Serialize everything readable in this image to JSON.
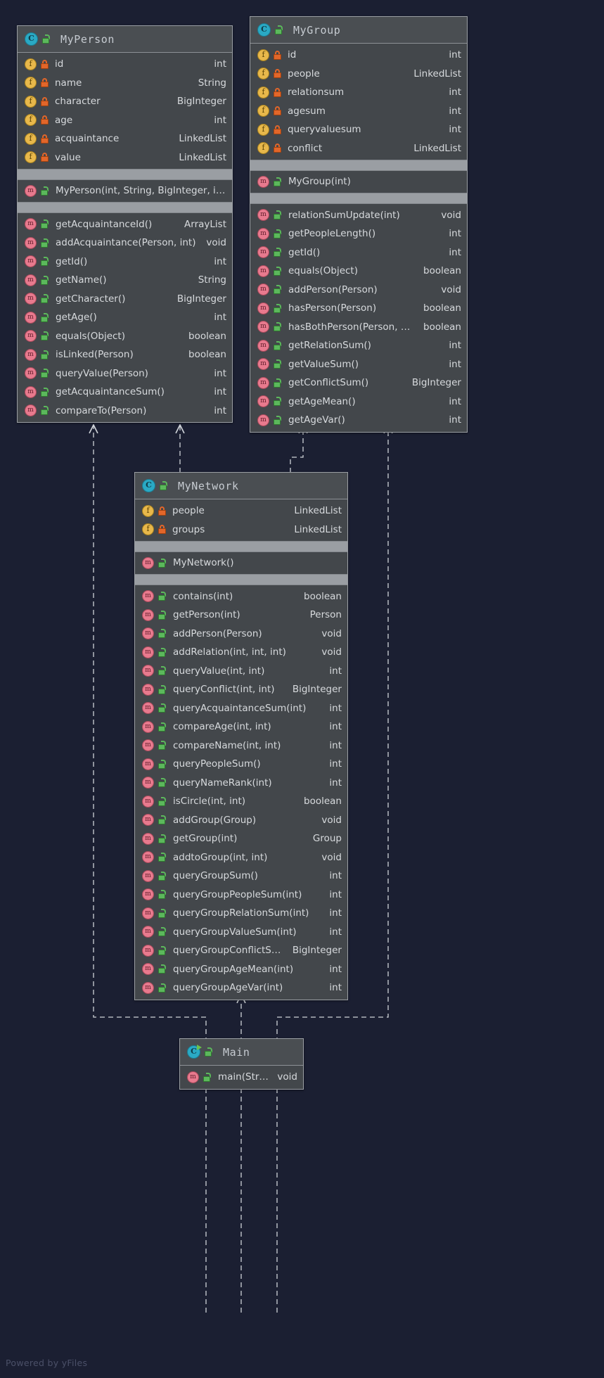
{
  "diagram": {
    "kind": "uml-class-diagram",
    "watermark": "Powered by yFiles",
    "background": "#1b1f32",
    "node_fill": "#43474b",
    "node_border": "#9a9ea3",
    "separator": "#9a9ea3",
    "text_color": "#d7dadd",
    "icons": {
      "class": "class-icon",
      "class_runnable": "class-runnable-icon",
      "field": "field-icon",
      "method": "method-icon",
      "private": "padlock-closed-icon",
      "public": "padlock-open-icon"
    },
    "edge_style": "dashed-hollow-triangle-realization"
  },
  "classes": [
    {
      "id": "myperson",
      "name": "MyPerson",
      "visibility": "public",
      "fields": [
        {
          "name": "id",
          "type": "int",
          "visibility": "private"
        },
        {
          "name": "name",
          "type": "String",
          "visibility": "private"
        },
        {
          "name": "character",
          "type": "BigInteger",
          "visibility": "private"
        },
        {
          "name": "age",
          "type": "int",
          "visibility": "private"
        },
        {
          "name": "acquaintance",
          "type": "LinkedList<Person>",
          "visibility": "private"
        },
        {
          "name": "value",
          "type": "LinkedList<Integer>",
          "visibility": "private"
        }
      ],
      "constructors": [
        {
          "name": "MyPerson(int, String, BigInteger, int)",
          "type": "",
          "visibility": "public"
        }
      ],
      "methods": [
        {
          "name": "getAcquaintanceId()",
          "type": "ArrayList<Integer>",
          "visibility": "public"
        },
        {
          "name": "addAcquaintance(Person, int)",
          "type": "void",
          "visibility": "public"
        },
        {
          "name": "getId()",
          "type": "int",
          "visibility": "public"
        },
        {
          "name": "getName()",
          "type": "String",
          "visibility": "public"
        },
        {
          "name": "getCharacter()",
          "type": "BigInteger",
          "visibility": "public"
        },
        {
          "name": "getAge()",
          "type": "int",
          "visibility": "public"
        },
        {
          "name": "equals(Object)",
          "type": "boolean",
          "visibility": "public"
        },
        {
          "name": "isLinked(Person)",
          "type": "boolean",
          "visibility": "public"
        },
        {
          "name": "queryValue(Person)",
          "type": "int",
          "visibility": "public"
        },
        {
          "name": "getAcquaintanceSum()",
          "type": "int",
          "visibility": "public"
        },
        {
          "name": "compareTo(Person)",
          "type": "int",
          "visibility": "public"
        }
      ]
    },
    {
      "id": "mygroup",
      "name": "MyGroup",
      "visibility": "public",
      "fields": [
        {
          "name": "id",
          "type": "int",
          "visibility": "private"
        },
        {
          "name": "people",
          "type": "LinkedList<Person>",
          "visibility": "private"
        },
        {
          "name": "relationsum",
          "type": "int",
          "visibility": "private"
        },
        {
          "name": "agesum",
          "type": "int",
          "visibility": "private"
        },
        {
          "name": "queryvaluesum",
          "type": "int",
          "visibility": "private"
        },
        {
          "name": "conflict",
          "type": "LinkedList<BigInteger>",
          "visibility": "private"
        }
      ],
      "constructors": [
        {
          "name": "MyGroup(int)",
          "type": "",
          "visibility": "public"
        }
      ],
      "methods": [
        {
          "name": "relationSumUpdate(int)",
          "type": "void",
          "visibility": "public"
        },
        {
          "name": "getPeopleLength()",
          "type": "int",
          "visibility": "public"
        },
        {
          "name": "getId()",
          "type": "int",
          "visibility": "public"
        },
        {
          "name": "equals(Object)",
          "type": "boolean",
          "visibility": "public"
        },
        {
          "name": "addPerson(Person)",
          "type": "void",
          "visibility": "public"
        },
        {
          "name": "hasPerson(Person)",
          "type": "boolean",
          "visibility": "public"
        },
        {
          "name": "hasBothPerson(Person, Person)",
          "type": "boolean",
          "visibility": "public"
        },
        {
          "name": "getRelationSum()",
          "type": "int",
          "visibility": "public"
        },
        {
          "name": "getValueSum()",
          "type": "int",
          "visibility": "public"
        },
        {
          "name": "getConflictSum()",
          "type": "BigInteger",
          "visibility": "public"
        },
        {
          "name": "getAgeMean()",
          "type": "int",
          "visibility": "public"
        },
        {
          "name": "getAgeVar()",
          "type": "int",
          "visibility": "public"
        }
      ]
    },
    {
      "id": "mynetwork",
      "name": "MyNetwork",
      "visibility": "public",
      "fields": [
        {
          "name": "people",
          "type": "LinkedList<Person>",
          "visibility": "private"
        },
        {
          "name": "groups",
          "type": "LinkedList<Group>",
          "visibility": "private"
        }
      ],
      "constructors": [
        {
          "name": "MyNetwork()",
          "type": "",
          "visibility": "public"
        }
      ],
      "methods": [
        {
          "name": "contains(int)",
          "type": "boolean",
          "visibility": "public"
        },
        {
          "name": "getPerson(int)",
          "type": "Person",
          "visibility": "public"
        },
        {
          "name": "addPerson(Person)",
          "type": "void",
          "visibility": "public"
        },
        {
          "name": "addRelation(int, int, int)",
          "type": "void",
          "visibility": "public"
        },
        {
          "name": "queryValue(int, int)",
          "type": "int",
          "visibility": "public"
        },
        {
          "name": "queryConflict(int, int)",
          "type": "BigInteger",
          "visibility": "public"
        },
        {
          "name": "queryAcquaintanceSum(int)",
          "type": "int",
          "visibility": "public"
        },
        {
          "name": "compareAge(int, int)",
          "type": "int",
          "visibility": "public"
        },
        {
          "name": "compareName(int, int)",
          "type": "int",
          "visibility": "public"
        },
        {
          "name": "queryPeopleSum()",
          "type": "int",
          "visibility": "public"
        },
        {
          "name": "queryNameRank(int)",
          "type": "int",
          "visibility": "public"
        },
        {
          "name": "isCircle(int, int)",
          "type": "boolean",
          "visibility": "public"
        },
        {
          "name": "addGroup(Group)",
          "type": "void",
          "visibility": "public"
        },
        {
          "name": "getGroup(int)",
          "type": "Group",
          "visibility": "public"
        },
        {
          "name": "addtoGroup(int, int)",
          "type": "void",
          "visibility": "public"
        },
        {
          "name": "queryGroupSum()",
          "type": "int",
          "visibility": "public"
        },
        {
          "name": "queryGroupPeopleSum(int)",
          "type": "int",
          "visibility": "public"
        },
        {
          "name": "queryGroupRelationSum(int)",
          "type": "int",
          "visibility": "public"
        },
        {
          "name": "queryGroupValueSum(int)",
          "type": "int",
          "visibility": "public"
        },
        {
          "name": "queryGroupConflictSum(int)",
          "type": "BigInteger",
          "visibility": "public"
        },
        {
          "name": "queryGroupAgeMean(int)",
          "type": "int",
          "visibility": "public"
        },
        {
          "name": "queryGroupAgeVar(int)",
          "type": "int",
          "visibility": "public"
        }
      ]
    },
    {
      "id": "main",
      "name": "Main",
      "visibility": "public",
      "runnable": true,
      "fields": [],
      "constructors": [],
      "methods": [
        {
          "name": "main(String[])",
          "type": "void",
          "visibility": "public"
        }
      ]
    }
  ],
  "edges": [
    {
      "from": "mynetwork",
      "to": "myperson",
      "type": "realization"
    },
    {
      "from": "mynetwork",
      "to": "mygroup",
      "type": "realization"
    },
    {
      "from": "main",
      "to": "myperson",
      "type": "realization"
    },
    {
      "from": "main",
      "to": "mygroup",
      "type": "realization"
    },
    {
      "from": "main",
      "to": "mynetwork",
      "type": "realization"
    }
  ]
}
